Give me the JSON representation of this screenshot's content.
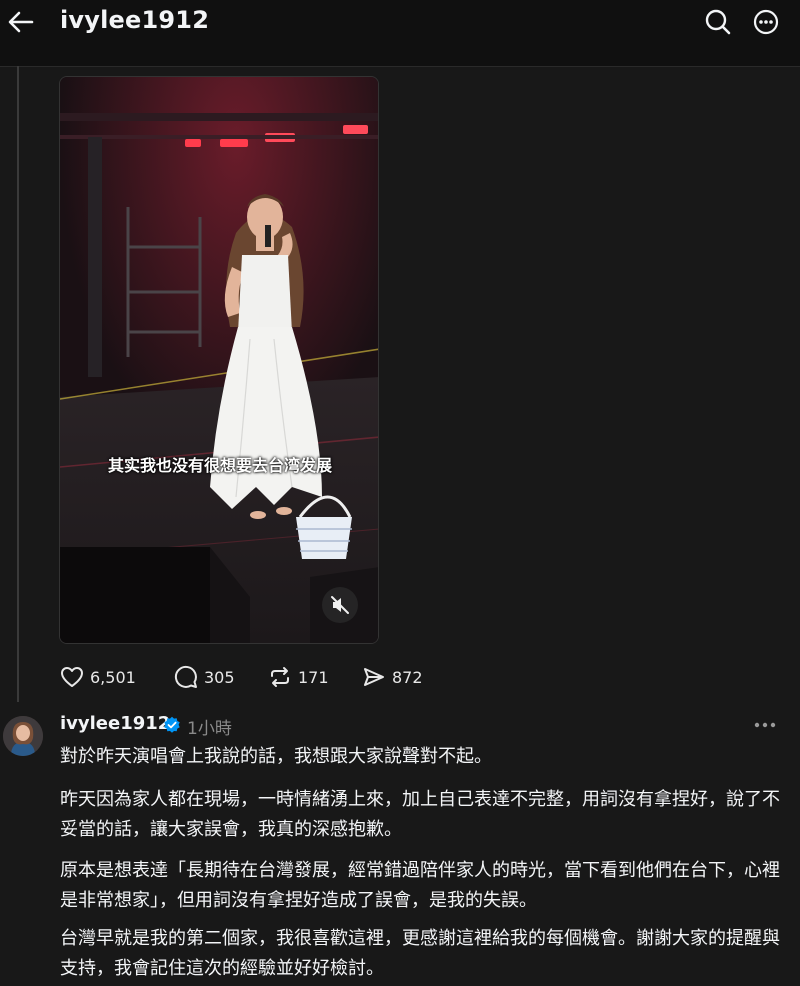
{
  "header": {
    "title": "ivylee1912"
  },
  "video": {
    "subtitle": "其实我也没有很想要去台湾发展"
  },
  "actions": {
    "likes": "6,501",
    "comments": "305",
    "reposts": "171",
    "shares": "872"
  },
  "reply": {
    "username": "ivylee1912",
    "time": "1小時",
    "paragraphs": [
      "對於昨天演唱會上我說的話，我想跟大家說聲對不起。",
      "昨天因為家人都在現場，一時情緒湧上來，加上自己表達不完整，用詞沒有拿捏好，說了不妥當的話，讓大家誤會，我真的深感抱歉。",
      "原本是想表達「長期待在台灣發展，經常錯過陪伴家人的時光，當下看到他們在台下，心裡是非常想家」，但用詞沒有拿捏好造成了誤會，是我的失誤。",
      "台灣早就是我的第二個家，我很喜歡這裡，更感謝這裡給我的每個機會。謝謝大家的提醒與支持，我會記住這次的經驗並好好檢討。"
    ]
  },
  "colors": {
    "background": "#101010",
    "panel": "#181818",
    "text": "#f3f5f7",
    "muted": "#8a8a8a",
    "verified": "#0095f6"
  }
}
